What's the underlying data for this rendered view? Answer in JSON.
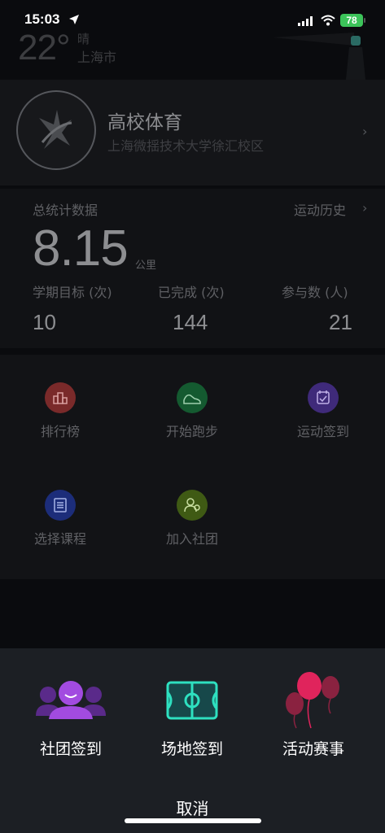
{
  "status_bar": {
    "time": "15:03",
    "battery": "78"
  },
  "weather": {
    "temp": "22°",
    "condition": "晴",
    "city": "上海市"
  },
  "school": {
    "title": "高校体育",
    "subtitle": "上海微揺技术大学徐汇校区"
  },
  "stats": {
    "title": "总统计数据",
    "history_link": "运动历史",
    "total_distance": "8.15",
    "unit": "公里",
    "columns": [
      {
        "label": "学期目标 (次)",
        "value": "10"
      },
      {
        "label": "已完成 (次)",
        "value": "144"
      },
      {
        "label": "参与数 (人)",
        "value": "21"
      }
    ]
  },
  "menu": [
    {
      "label": "排行榜",
      "icon": "ranking-icon",
      "color": "#c23b3b"
    },
    {
      "label": "开始跑步",
      "icon": "shoe-icon",
      "color": "#1f8f4a"
    },
    {
      "label": "运动签到",
      "icon": "calendar-check-icon",
      "color": "#6b3fc4"
    },
    {
      "label": "选择课程",
      "icon": "course-list-icon",
      "color": "#2847b8"
    },
    {
      "label": "加入社团",
      "icon": "group-icon",
      "color": "#5e8f1f"
    }
  ],
  "sheet": {
    "options": [
      {
        "label": "社团签到",
        "icon": "club-people-icon"
      },
      {
        "label": "场地签到",
        "icon": "soccer-field-icon"
      },
      {
        "label": "活动赛事",
        "icon": "balloons-icon"
      }
    ],
    "cancel": "取消"
  }
}
